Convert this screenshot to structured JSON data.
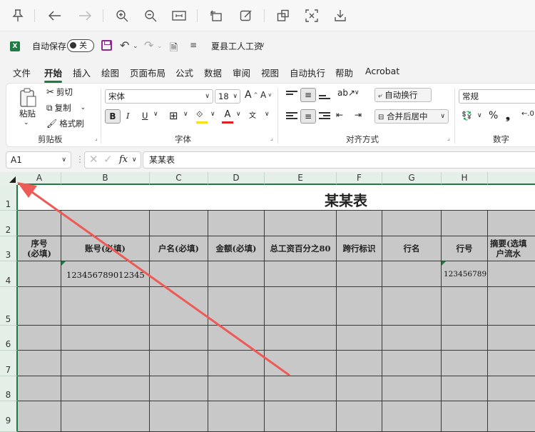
{
  "quick_access": {
    "autosave_label": "自动保存",
    "toggle_state": "关",
    "doc_title": "夏县工人工资"
  },
  "tabs": [
    "文件",
    "开始",
    "插入",
    "绘图",
    "页面布局",
    "公式",
    "数据",
    "审阅",
    "视图",
    "自动执行",
    "帮助",
    "Acrobat"
  ],
  "ribbon": {
    "clipboard": {
      "paste": "粘贴",
      "cut": "剪切",
      "copy": "复制",
      "format_painter": "格式刷",
      "label": "剪贴板"
    },
    "font": {
      "name": "宋体",
      "size": "18",
      "bold": "B",
      "italic": "I",
      "underline": "U",
      "label": "字体"
    },
    "alignment": {
      "wrap": "自动换行",
      "merge": "合并后居中",
      "label": "对齐方式"
    },
    "number": {
      "format": "常规",
      "label": "数字"
    }
  },
  "formula_bar": {
    "name_box": "A1",
    "fx": "fx",
    "value": "某某表"
  },
  "columns": [
    "A",
    "B",
    "C",
    "D",
    "E",
    "F",
    "G",
    "H"
  ],
  "rows": [
    "1",
    "2",
    "3",
    "4",
    "5",
    "6",
    "7",
    "8",
    "9"
  ],
  "sheet": {
    "title": "某某表",
    "headers": [
      "序号\n(必填)",
      "账号(必填)",
      "户名(必填)",
      "金额(必填)",
      "总工资百分之80",
      "跨行标识",
      "行名",
      "行号",
      "摘要(选填\n户流水"
    ],
    "row4": {
      "account": "123456789012345",
      "bank_no": "123456789"
    }
  }
}
